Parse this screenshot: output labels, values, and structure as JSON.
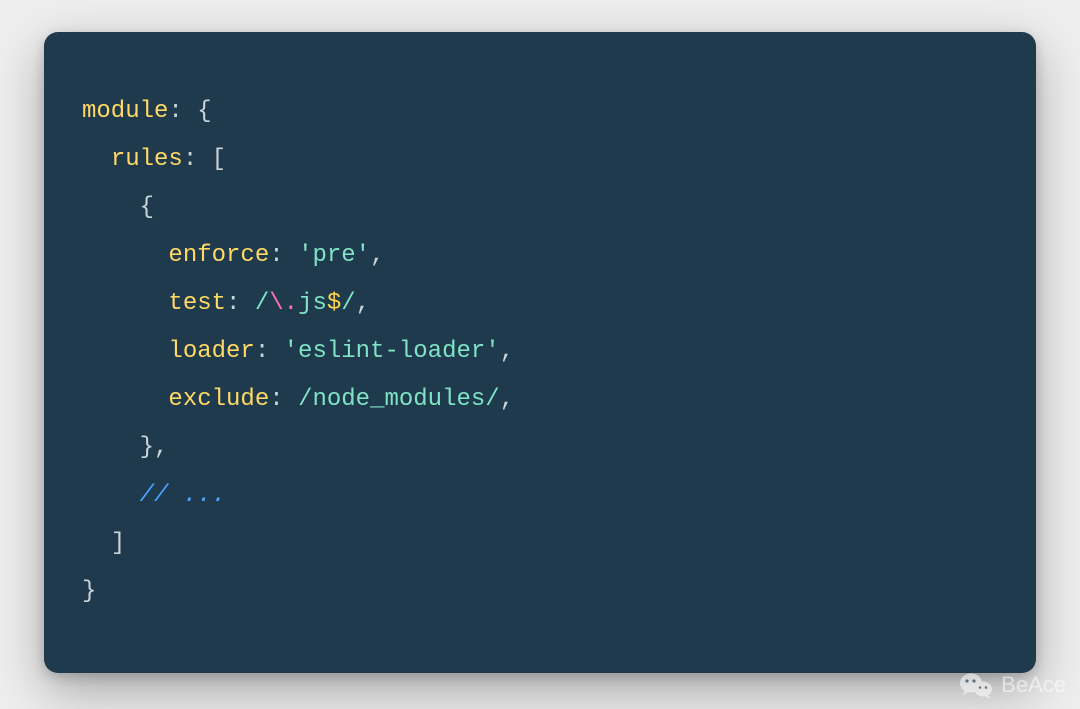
{
  "code": {
    "lines": [
      {
        "indent": 0,
        "segments": [
          {
            "cls": "tok-key",
            "text": "module"
          },
          {
            "cls": "tok-punc",
            "text": ": {"
          }
        ]
      },
      {
        "indent": 1,
        "segments": [
          {
            "cls": "tok-key",
            "text": "rules"
          },
          {
            "cls": "tok-punc",
            "text": ": ["
          }
        ]
      },
      {
        "indent": 2,
        "segments": [
          {
            "cls": "tok-punc",
            "text": "{"
          }
        ]
      },
      {
        "indent": 3,
        "segments": [
          {
            "cls": "tok-key",
            "text": "enforce"
          },
          {
            "cls": "tok-punc",
            "text": ": "
          },
          {
            "cls": "tok-string",
            "text": "'pre'"
          },
          {
            "cls": "tok-punc",
            "text": ","
          }
        ]
      },
      {
        "indent": 3,
        "segments": [
          {
            "cls": "tok-key",
            "text": "test"
          },
          {
            "cls": "tok-punc",
            "text": ": "
          },
          {
            "cls": "tok-regex",
            "text": "/"
          },
          {
            "cls": "tok-escape",
            "text": "\\."
          },
          {
            "cls": "tok-regex",
            "text": "js"
          },
          {
            "cls": "tok-anchor",
            "text": "$"
          },
          {
            "cls": "tok-regex",
            "text": "/"
          },
          {
            "cls": "tok-punc",
            "text": ","
          }
        ]
      },
      {
        "indent": 3,
        "segments": [
          {
            "cls": "tok-key",
            "text": "loader"
          },
          {
            "cls": "tok-punc",
            "text": ": "
          },
          {
            "cls": "tok-string",
            "text": "'eslint-loader'"
          },
          {
            "cls": "tok-punc",
            "text": ","
          }
        ]
      },
      {
        "indent": 3,
        "segments": [
          {
            "cls": "tok-key",
            "text": "exclude"
          },
          {
            "cls": "tok-punc",
            "text": ": "
          },
          {
            "cls": "tok-regex",
            "text": "/node_modules/"
          },
          {
            "cls": "tok-punc",
            "text": ","
          }
        ]
      },
      {
        "indent": 2,
        "segments": [
          {
            "cls": "tok-punc",
            "text": "},"
          }
        ]
      },
      {
        "indent": 2,
        "segments": [
          {
            "cls": "tok-comment",
            "text": "// ..."
          }
        ]
      },
      {
        "indent": 1,
        "segments": [
          {
            "cls": "tok-punc",
            "text": "]"
          }
        ]
      },
      {
        "indent": 0,
        "segments": [
          {
            "cls": "tok-punc",
            "text": "}"
          }
        ]
      }
    ],
    "indent_unit": "  "
  },
  "watermark": {
    "label": "BeAce",
    "icon_name": "wechat-icon"
  }
}
